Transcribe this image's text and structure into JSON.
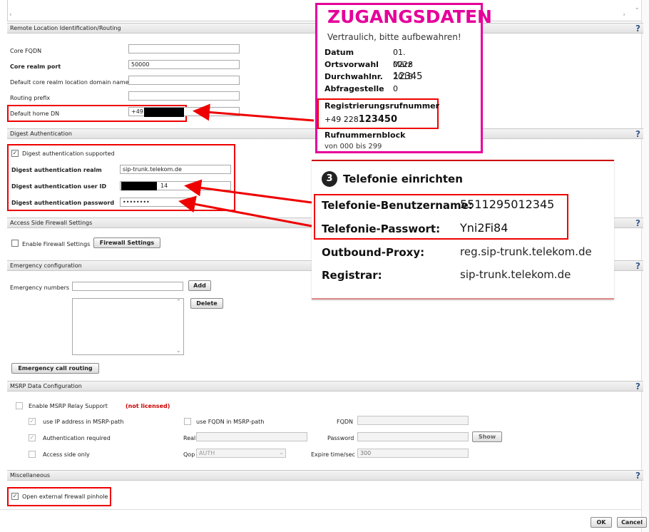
{
  "sections": {
    "routing": "Remote Location Identification/Routing",
    "digest": "Digest Authentication",
    "firewall": "Access Side Firewall Settings",
    "emergency": "Emergency configuration",
    "msrp": "MSRP Data Configuration",
    "misc": "Miscellaneous"
  },
  "help_label": "?",
  "routing": {
    "core_fqdn_label": "Core FQDN",
    "core_fqdn_value": "",
    "core_realm_port_label": "Core realm port",
    "core_realm_port_value": "50000",
    "default_domain_label": "Default core realm location domain name",
    "default_domain_value": "",
    "routing_prefix_label": "Routing prefix",
    "routing_prefix_value": "",
    "default_home_dn_label": "Default home DN",
    "default_home_dn_value": "+49"
  },
  "digest": {
    "supported_label": "Digest authentication supported",
    "realm_label": "Digest authentication realm",
    "realm_value": "sip-trunk.telekom.de",
    "user_label": "Digest authentication user ID",
    "user_value_suffix": "14",
    "password_label": "Digest authentication password",
    "password_value": "••••••••"
  },
  "firewall": {
    "enable_label": "Enable Firewall Settings",
    "settings_button": "Firewall Settings"
  },
  "emergency": {
    "numbers_label": "Emergency numbers",
    "add_button": "Add",
    "delete_button": "Delete",
    "routing_button": "Emergency call routing"
  },
  "msrp": {
    "enable_label": "Enable MSRP Relay Support",
    "not_licensed": "(not licensed)",
    "use_ip_label": "use IP address in MSRP-path",
    "use_fqdn_label": "use FQDN in MSRP-path",
    "fqdn_label": "FQDN",
    "auth_required_label": "Authentication required",
    "realm_label": "Realm",
    "password_label": "Password",
    "show_button": "Show",
    "access_only_label": "Access side only",
    "qop_label": "Qop",
    "qop_value": "AUTH",
    "expire_label": "Expire time/sec",
    "expire_value": "300"
  },
  "misc": {
    "pinhole_label": "Open external firewall pinhole"
  },
  "footer": {
    "ok_button": "OK",
    "cancel_button": "Cancel"
  },
  "overlay_zugang": {
    "title": "ZUGANGSDATEN",
    "subtitle": "Vertraulich, bitte aufbewahren!",
    "rows": [
      {
        "k": "Datum",
        "v": "01. März 2018"
      },
      {
        "k": "Ortsvorwahl",
        "v": "0228"
      },
      {
        "k": "Durchwahlnr.",
        "v": "12345"
      },
      {
        "k": "Abfragestelle",
        "v": "0"
      }
    ],
    "reg_label": "Registrierungsrufnummer",
    "reg_value_prefix": "+49 228",
    "reg_value_bold": "123450",
    "block_label": "Rufnummernblock",
    "block_value": "von 000 bis 299"
  },
  "overlay_telefonie": {
    "step": "3",
    "title": "Telefonie einrichten",
    "rows": [
      {
        "k": "Telefonie-Benutzername:",
        "v": "5511295012345"
      },
      {
        "k": "Telefonie-Passwort:",
        "v": "Yni2Fi84"
      },
      {
        "k": "Outbound-Proxy:",
        "v": "reg.sip-trunk.telekom.de"
      },
      {
        "k": "Registrar:",
        "v": "sip-trunk.telekom.de"
      }
    ]
  },
  "colors": {
    "magenta": "#e5009a",
    "red": "#e00000"
  }
}
